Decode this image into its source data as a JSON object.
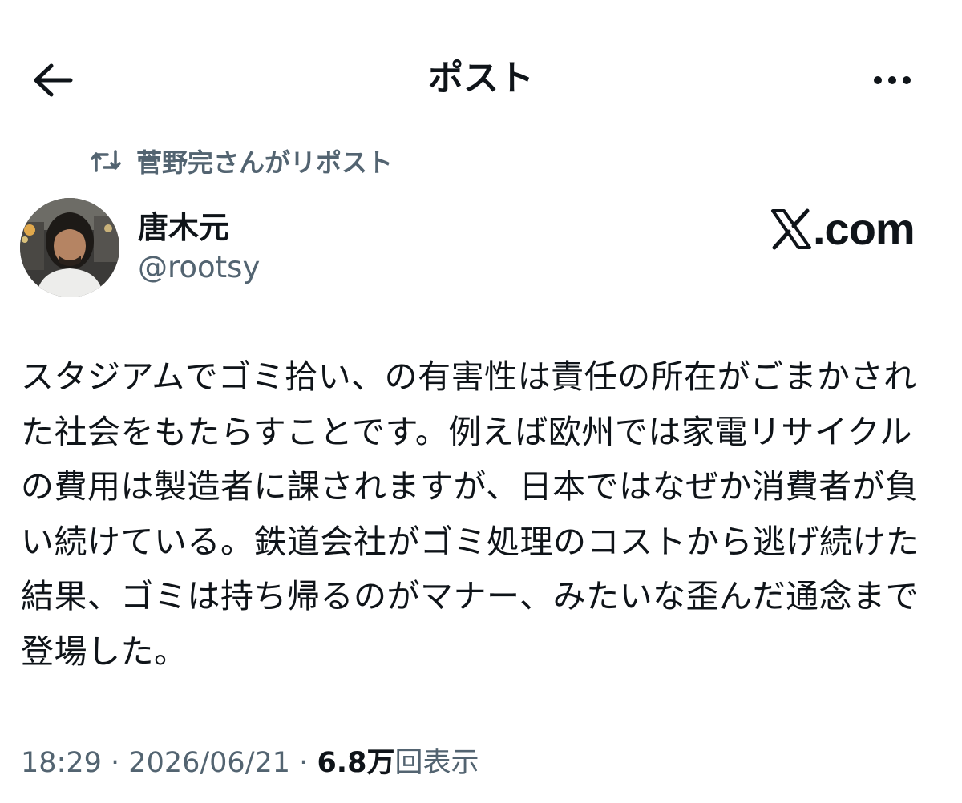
{
  "header": {
    "title": "ポスト",
    "back_icon": "arrow-left-icon",
    "more_icon": "more-horizontal-icon"
  },
  "repost": {
    "icon": "repost-icon",
    "label": "菅野完さんがリポスト"
  },
  "author": {
    "name": "唐木元",
    "handle": "@rootsy"
  },
  "watermark": {
    "logo_icon": "x-logo-icon",
    "text": ".com"
  },
  "post": {
    "text": "スタジアムでゴミ拾い、の有害性は責任の所在がごまかされた社会をもたらすことです。例えば欧州では家電リサイクルの費用は製造者に課されますが、日本ではなぜか消費者が負い続けている。鉄道会社がゴミ処理のコストから逃げ続けた結果、ゴミは持ち帰るのがマナー、みたいな歪んだ通念まで登場した。"
  },
  "meta": {
    "time": "18:29",
    "date": "2026/06/21",
    "separator": "·",
    "views_count": "6.8万",
    "views_label": "回表示"
  },
  "colors": {
    "text_primary": "#0f1419",
    "text_secondary": "#536471",
    "background": "#ffffff"
  }
}
